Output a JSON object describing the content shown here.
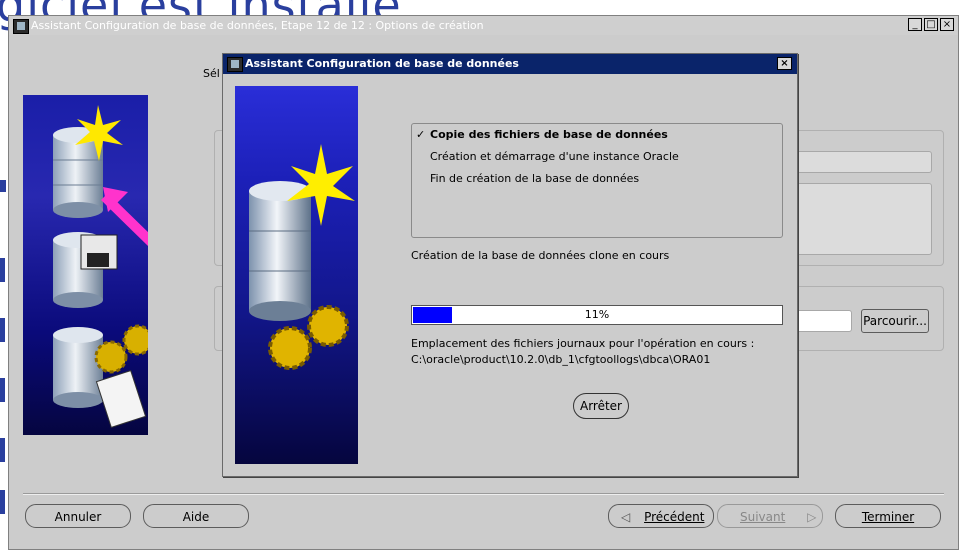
{
  "background": {
    "text": "giciel est installé"
  },
  "main_window": {
    "title": "Assistant Configuration de base de données, Etape 12 de 12 : Options de création",
    "window_buttons": [
      "_",
      "□",
      "×"
    ],
    "partial_label": "Sél",
    "buttons": {
      "cancel": "Annuler",
      "help": "Aide",
      "previous": "Précédent",
      "next": "Suivant",
      "finish": "Terminer",
      "browse": "Parcourir..."
    }
  },
  "dialog": {
    "title": "Assistant Configuration de base de données",
    "close_symbol": "×",
    "steps": [
      {
        "label": "Copie des fichiers de base de données",
        "done": true
      },
      {
        "label": "Création et démarrage d'une instance Oracle",
        "done": false
      },
      {
        "label": "Fin de création de la base de données",
        "done": false
      }
    ],
    "check_glyph": "✓",
    "status": "Création de la base de données clone en cours",
    "progress": {
      "percent": 11,
      "label": "11%"
    },
    "log_label": "Emplacement des fichiers journaux pour l'opération en cours :",
    "log_path": "C:\\oracle\\product\\10.2.0\\db_1\\cfgtoollogs\\dbca\\ORA01",
    "stop_button": "Arrêter"
  },
  "colors": {
    "dialog_title_bg": "#0a246a",
    "progress_fill": "#0000ff",
    "window_bg": "#cccccc"
  }
}
